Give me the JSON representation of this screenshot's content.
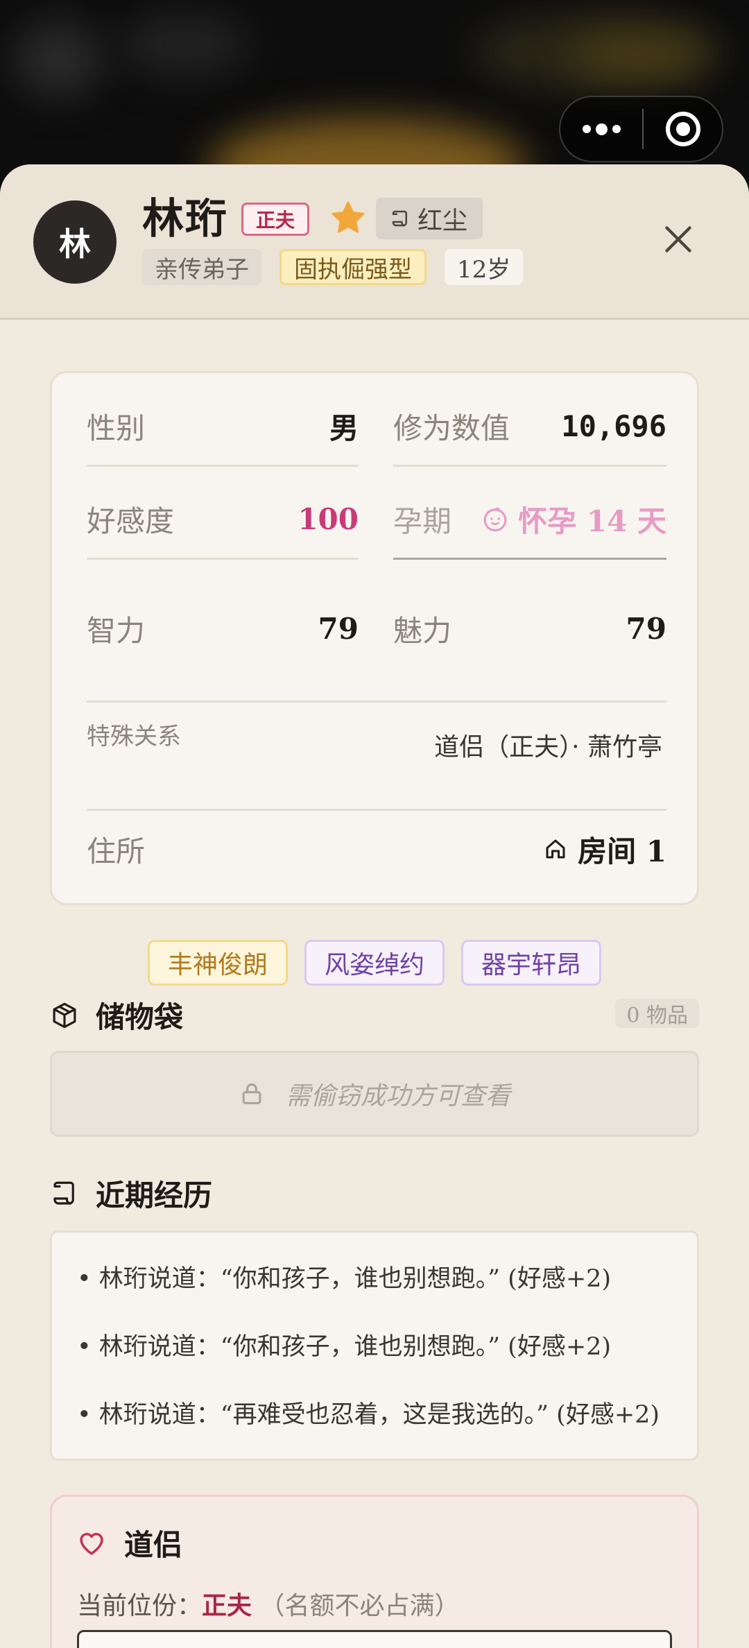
{
  "character": {
    "avatar_char": "林",
    "name": "林珩",
    "role_badge": "正夫",
    "realm_badge": "红尘",
    "tags": [
      "亲传弟子",
      "固执倔强型",
      "12岁"
    ]
  },
  "stats": {
    "gender_label": "性别",
    "gender_value": "男",
    "cultivation_label": "修为数值",
    "cultivation_value": "10,696",
    "affection_label": "好感度",
    "affection_value": "100",
    "pregnancy_label": "孕期",
    "pregnancy_value": "怀孕 14 天",
    "intellect_label": "智力",
    "intellect_value": "79",
    "charm_label": "魅力",
    "charm_value": "79",
    "relation_label": "特殊关系",
    "relation_value": "道侣（正夫）· 萧竹亭",
    "residence_label": "住所",
    "residence_value": "房间 1"
  },
  "traits": [
    "丰神俊朗",
    "风姿绰约",
    "器宇轩昂"
  ],
  "storage": {
    "title": "储物袋",
    "count": "0 物品",
    "locked_text": "需偷窃成功方可查看"
  },
  "history": {
    "title": "近期经历",
    "items": [
      "• 林珩说道：“你和孩子，谁也别想跑。” (好感+2)",
      "• 林珩说道：“你和孩子，谁也别想跑。” (好感+2)",
      "• 林珩说道：“再难受也忍着，这是我选的。” (好感+2)"
    ]
  },
  "partner": {
    "title": "道侣",
    "position_label": "当前位份：",
    "position_value": "正夫",
    "position_note": "（名额不必占满）"
  },
  "colors": {
    "sheet_bg": "#f1eadf",
    "affection": "#c93a78",
    "pregnancy": "#e79bc4",
    "partner_accent": "#a8264a"
  }
}
